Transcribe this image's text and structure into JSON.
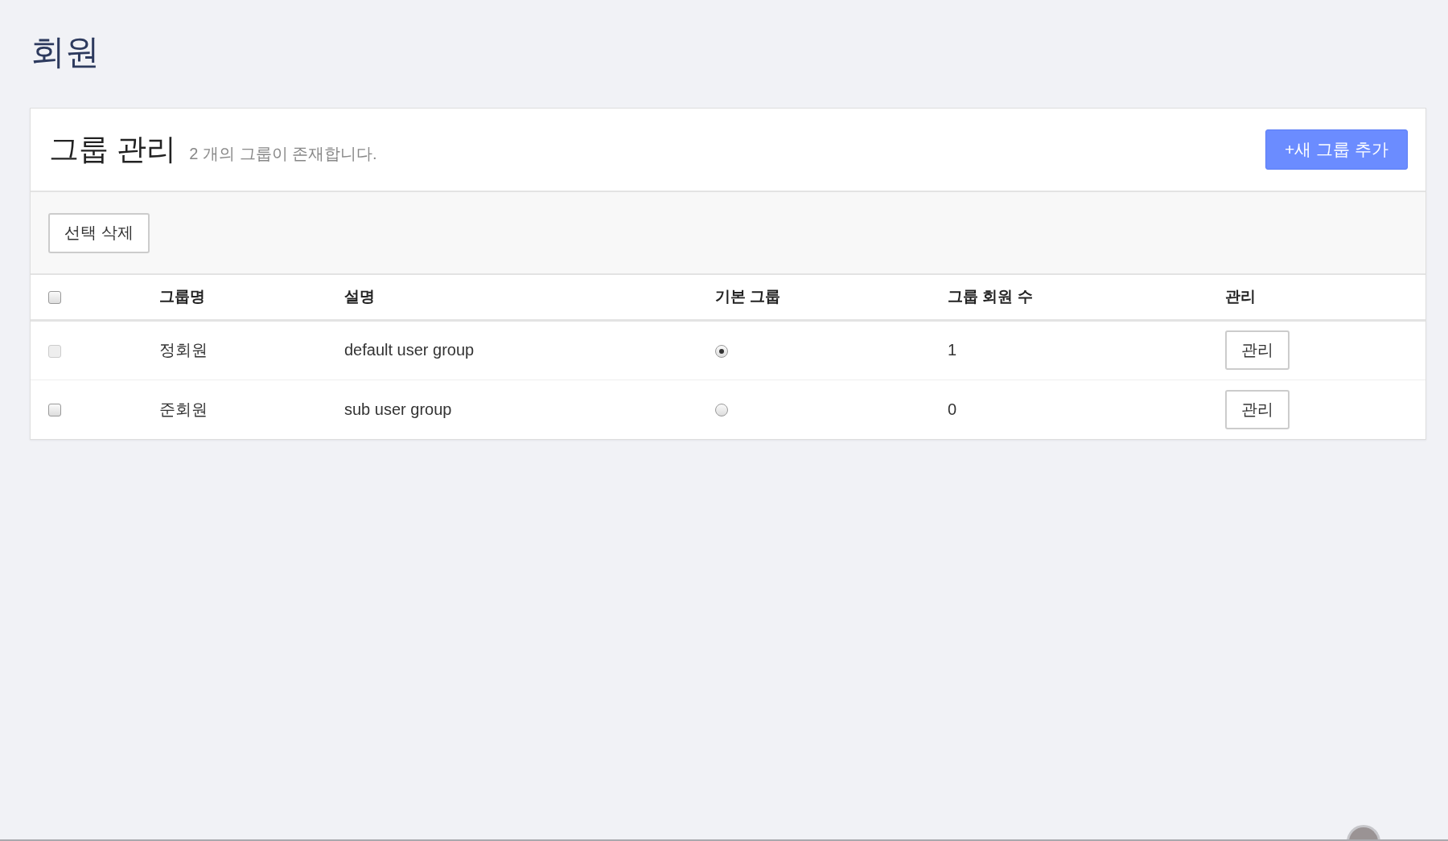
{
  "page_title": "회원",
  "panel": {
    "title": "그룹 관리",
    "subtitle": "2 개의 그룹이 존재합니다.",
    "add_button": "+새 그룹 추가"
  },
  "toolbar": {
    "delete_button": "선택 삭제"
  },
  "table": {
    "select_all": {
      "checked": false
    },
    "columns": [
      "그룹명",
      "설명",
      "기본 그룹",
      "그룹 회원 수",
      "관리"
    ],
    "rows": [
      {
        "checked": false,
        "disabled": true,
        "name": "정회원",
        "description": "default user group",
        "default": true,
        "members": "1",
        "manage": "관리"
      },
      {
        "checked": false,
        "disabled": false,
        "name": "준회원",
        "description": "sub user group",
        "default": false,
        "members": "0",
        "manage": "관리"
      }
    ]
  }
}
